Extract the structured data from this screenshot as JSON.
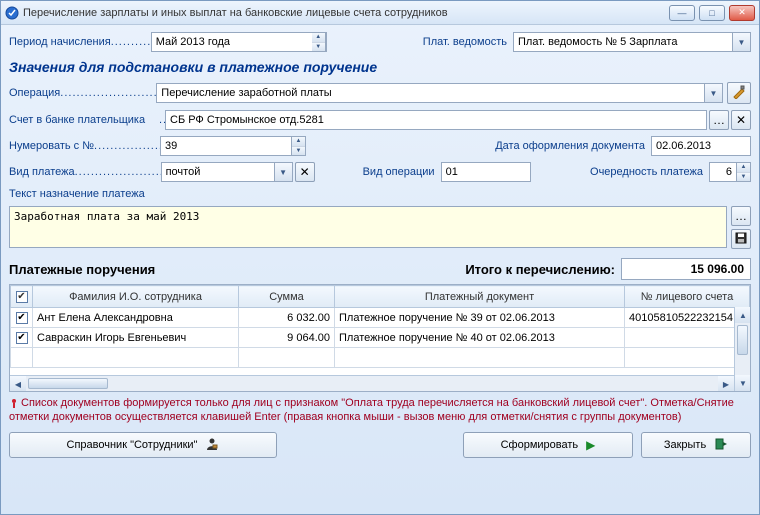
{
  "window": {
    "title": "Перечисление зарплаты и иных выплат на банковские лицевые счета сотрудников"
  },
  "top": {
    "period_label": "Период начисления",
    "period_value": "Май 2013 года",
    "sheet_label": "Плат. ведомость",
    "sheet_value": "Плат. ведомость № 5 Зарплата"
  },
  "section1": {
    "heading": "Значения для подстановки в платежное поручение",
    "operation_label": "Операция",
    "operation_value": "Перечисление заработной платы",
    "payer_account_label": "Счет в банке плательщика",
    "payer_account_value": "СБ РФ Стромынское отд.5281",
    "number_from_label": "Нумеровать с №",
    "number_from_value": "39",
    "doc_date_label": "Дата оформления документа",
    "doc_date_value": "02.06.2013",
    "pay_type_label": "Вид платежа",
    "pay_type_value": "почтой",
    "oper_type_label": "Вид операции",
    "oper_type_value": "01",
    "priority_label": "Очередность платежа",
    "priority_value": "6",
    "memo_label": "Текст назначение платежа",
    "memo_value": "Заработная плата за май 2013"
  },
  "orders": {
    "heading": "Платежные поручения",
    "total_label": "Итого к перечислению:",
    "total_value": "15 096.00",
    "columns": {
      "chk": "",
      "name": "Фамилия И.О. сотрудника",
      "sum": "Сумма",
      "doc": "Платежный документ",
      "acct": "№ лицевого счета"
    },
    "rows": [
      {
        "checked": true,
        "name": "Ант Елена Александровна",
        "sum": "6 032.00",
        "doc": "Платежное поручение № 39 от 02.06.2013",
        "acct": "40105810522232154"
      },
      {
        "checked": true,
        "name": "Савраскин Игорь Евгеньевич",
        "sum": "9 064.00",
        "doc": "Платежное поручение № 40 от 02.06.2013",
        "acct": ""
      }
    ]
  },
  "info": "Список документов формируется только для лиц с признаком \"Оплата труда перечисляется на банковский лицевой счет\". Отметка/Снятие отметки документов осуществляется клавишей Enter (правая кнопка мыши - вызов меню для отметки/снятия с группы документов)",
  "buttons": {
    "employees": "Справочник \"Сотрудники\"",
    "generate": "Сформировать",
    "close": "Закрыть"
  }
}
